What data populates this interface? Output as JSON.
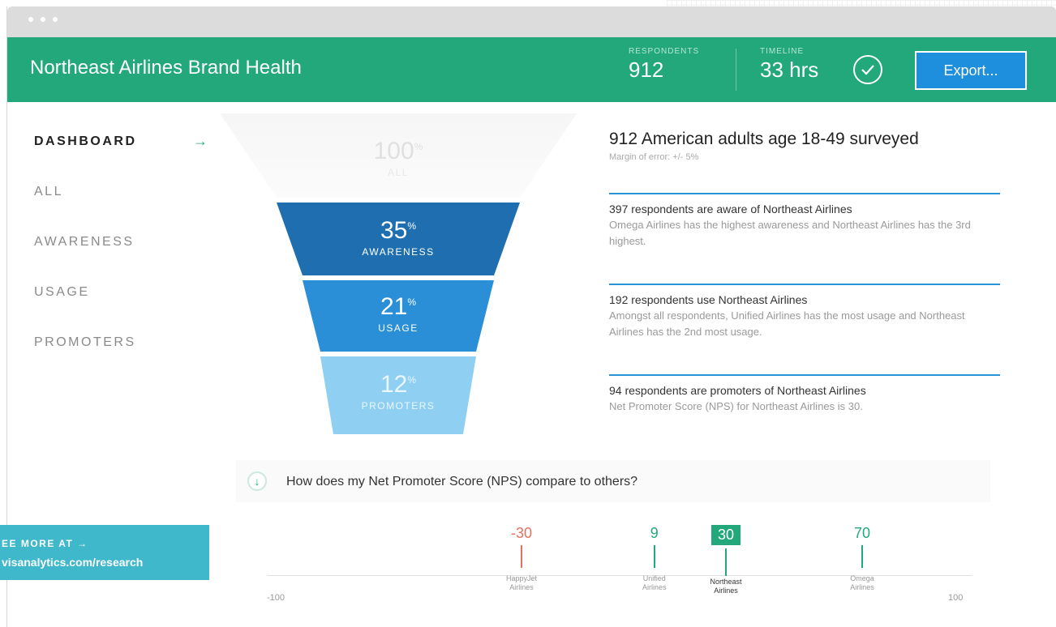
{
  "header": {
    "title": "Northeast Airlines Brand Health",
    "respondents_label": "RESPONDENTS",
    "respondents_value": "912",
    "timeline_label": "TIMELINE",
    "timeline_value": "33 hrs",
    "export_label": "Export..."
  },
  "nav": {
    "items": [
      "DASHBOARD",
      "ALL",
      "AWARENESS",
      "USAGE",
      "PROMOTERS"
    ],
    "active_arrow": "→"
  },
  "funnel": [
    {
      "value": "100",
      "unit": "%",
      "label": "ALL"
    },
    {
      "value": "35",
      "unit": "%",
      "label": "AWARENESS"
    },
    {
      "value": "21",
      "unit": "%",
      "label": "USAGE"
    },
    {
      "value": "12",
      "unit": "%",
      "label": "PROMOTERS"
    }
  ],
  "summary": {
    "title": "912 American adults age 18-49 surveyed",
    "margin": "Margin of error: +/- 5%",
    "facts": [
      {
        "title": "397 respondents are aware of Northeast Airlines",
        "desc": "Omega Airlines has the highest awareness and Northeast Airlines has the 3rd highest."
      },
      {
        "title": "192 respondents use Northeast Airlines",
        "desc": "Amongst all respondents, Unified Airlines has the most usage and Northeast Airlines has the 2nd most usage."
      },
      {
        "title": "94 respondents are promoters of Northeast Airlines",
        "desc": "Net Promoter Score (NPS) for Northeast Airlines is 30."
      }
    ]
  },
  "compare": {
    "icon": "↓",
    "question": "How does my Net Promoter Score (NPS) compare to others?"
  },
  "nps_scale": {
    "min_label": "-100",
    "max_label": "100",
    "markers": [
      {
        "value": -30,
        "display": "-30",
        "name": "HappyJet\nAirlines",
        "color": "#e8705e"
      },
      {
        "value": 9,
        "display": "9",
        "name": "Unified\nAirlines",
        "color": "#22a87a"
      },
      {
        "value": 30,
        "display": "30",
        "name": "Northeast\nAirlines",
        "color": "#22a87a",
        "highlight": true
      },
      {
        "value": 70,
        "display": "70",
        "name": "Omega\nAirlines",
        "color": "#22a87a"
      }
    ]
  },
  "promo": {
    "line1": "EE MORE AT →",
    "line2": "visanalytics.com/research"
  },
  "colors": {
    "brand_green": "#22a87a",
    "export_blue": "#1d8fdc",
    "awareness": "#1f6fb0",
    "usage": "#2a8fd6",
    "promoters": "#8fd0f2"
  }
}
